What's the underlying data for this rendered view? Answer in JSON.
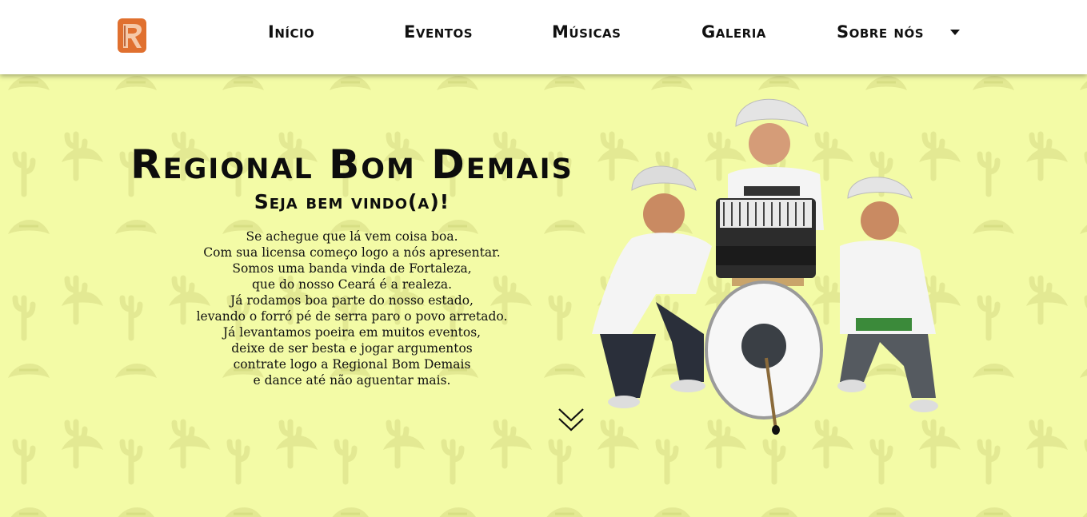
{
  "header": {
    "logo": {
      "icon": "band-logo-r-icon",
      "accent": "#e0702f"
    },
    "nav": [
      {
        "label": "Início"
      },
      {
        "label": "Eventos"
      },
      {
        "label": "Músicas"
      },
      {
        "label": "Galeria"
      },
      {
        "label": "Sobre nós",
        "icon": "caret-down-icon"
      }
    ]
  },
  "hero": {
    "title": "Regional Bom Demais",
    "subtitle": "Seja bem vindo(a)!",
    "poem": [
      "Se achegue que lá vem coisa boa.",
      "Com sua licensa começo logo a nós apresentar.",
      "Somos uma banda vinda de Fortaleza,",
      "que do nosso Ceará é a realeza.",
      "Já rodamos boa parte do nosso estado,",
      "levando o forró pé de serra paro o povo arretado.",
      "Já levantamos poeira em muitos eventos,",
      "deixe de ser besta e jogar argumentos",
      "contrate logo a Regional Bom Demais",
      "e dance até não aguentar mais."
    ],
    "scroll_icon": "double-chevron-down-icon",
    "background_color": "#f3fba6",
    "pattern_color": "#e3e993"
  }
}
